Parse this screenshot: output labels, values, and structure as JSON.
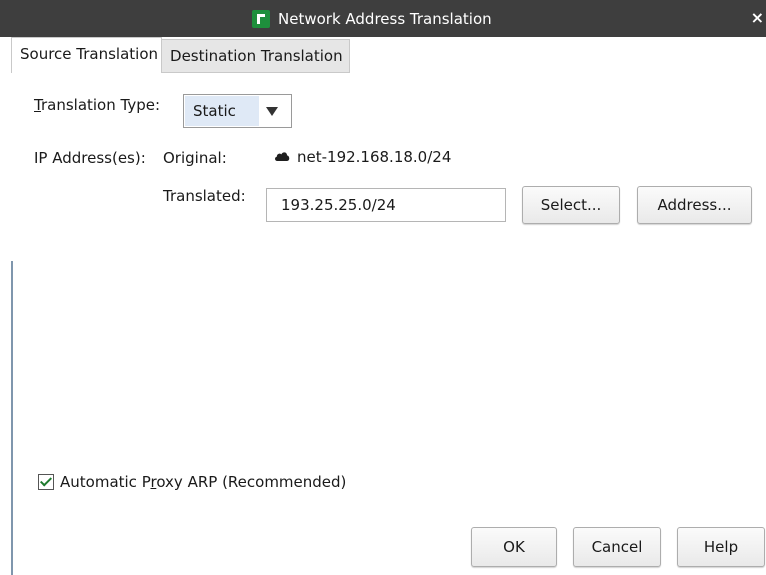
{
  "window": {
    "title": "Network Address Translation",
    "close_glyph": "×"
  },
  "tabs": [
    {
      "label": "Source Translation",
      "active": true
    },
    {
      "label": "Destination Translation",
      "active": false
    }
  ],
  "form": {
    "translation_type_label_prefix": "",
    "translation_type_label_mnemonic": "T",
    "translation_type_label_rest": "ranslation Type:",
    "translation_type_value": "Static",
    "ip_addresses_label": "IP Address(es):",
    "original_label": "Original:",
    "original_value": "net-192.168.18.0/24",
    "original_icon": "cloud-icon",
    "translated_label": "Translated:",
    "translated_value": "193.25.25.0/24",
    "select_button": "Select...",
    "address_button": "Address..."
  },
  "proxy_arp": {
    "checked": true,
    "label_prefix": "Automatic P",
    "label_mnemonic": "r",
    "label_rest": "oxy ARP (Recommended)"
  },
  "footer": {
    "ok": "OK",
    "cancel": "Cancel",
    "help": "Help"
  },
  "colors": {
    "titlebar": "#3e3e3e",
    "app_icon": "#1e8f3c",
    "select_highlight": "#dfe9f6",
    "checkmark": "#1e7a2e"
  }
}
